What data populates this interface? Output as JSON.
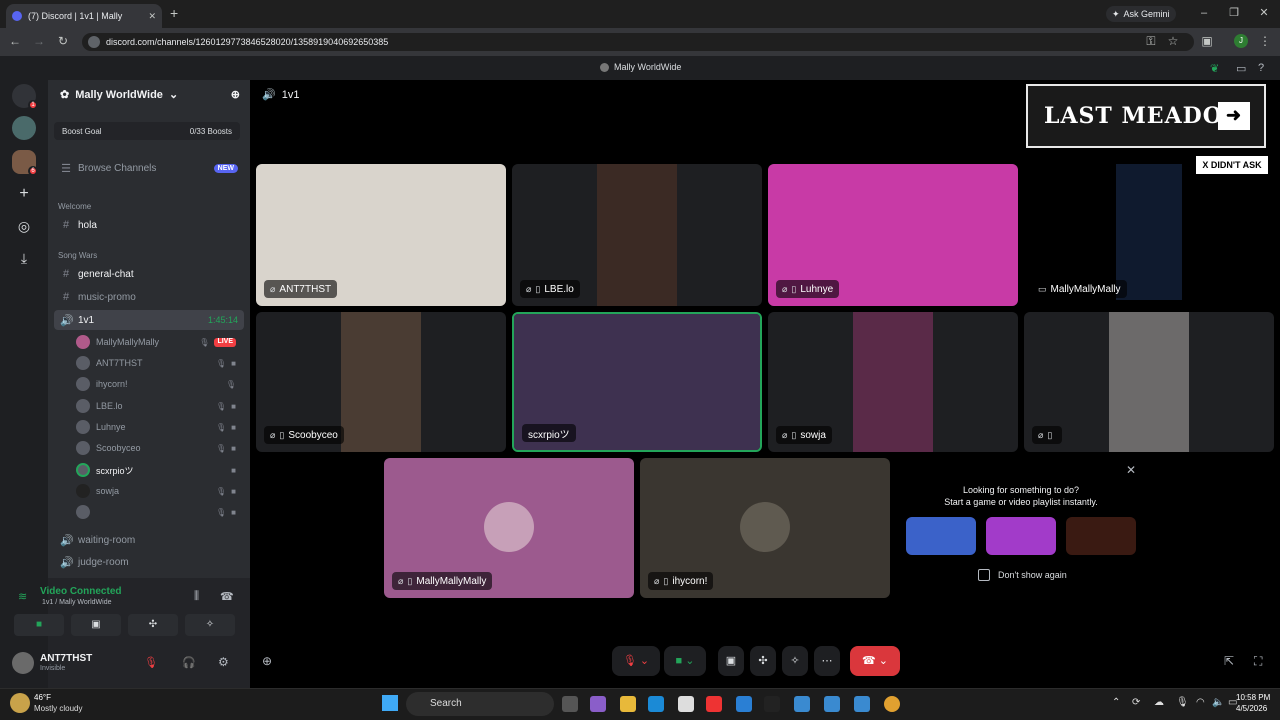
{
  "browser": {
    "tab_title": "(7) Discord | 1v1 | Mally",
    "url": "discord.com/channels/1260129773846528020/1358919040692650385",
    "ask_gemini": "Ask Gemini"
  },
  "header": {
    "title": "Mally WorldWide"
  },
  "rail": {
    "home_badge": "1",
    "server_badge": "6"
  },
  "sidebar": {
    "guild_name": "Mally WorldWide",
    "boost_goal": "Boost Goal",
    "boost_count": "0/33 Boosts",
    "browse": "Browse Channels",
    "browse_badge": "NEW",
    "cat_welcome": "Welcome",
    "ch_hola": "hola",
    "cat_songwars": "Song Wars",
    "ch_general": "general-chat",
    "ch_promo": "music-promo",
    "ch_1v1": "1v1",
    "ch_1v1_time": "1:45:14",
    "users": [
      "MallyMallyMally",
      "ANT7THST",
      "ihycorn!",
      "LBE.lo",
      "Luhnye",
      "Scoobyceo",
      "scxrpioツ",
      "sowja",
      ""
    ],
    "live_badge": "LIVE",
    "ch_waiting": "waiting-room",
    "ch_judge": "judge-room"
  },
  "voice": {
    "status": "Video Connected",
    "sub": "1v1 / Mally WorldWide"
  },
  "account": {
    "name": "ANT7THST",
    "status": "Invisible"
  },
  "channel_header": "1v1",
  "tiles": [
    {
      "name": "ANT7THST",
      "color": "#d9d4cc"
    },
    {
      "name": "LBE.lo",
      "color": "#3b2a24"
    },
    {
      "name": "Luhnye",
      "color": "#c83aa6"
    },
    {
      "name": "MallyMallyMally",
      "color": "#000000"
    },
    {
      "name": "Scoobyceo",
      "color": "#4a3c33"
    },
    {
      "name": "scxrpioツ",
      "color": "#3e3150"
    },
    {
      "name": "sowja",
      "color": "#5a2a48"
    },
    {
      "name": "",
      "color": "#6c6a6a"
    },
    {
      "name": "MallyMallyMally",
      "color": "#9c5a8e"
    },
    {
      "name": "ihycorn!",
      "color": "#3a3630"
    }
  ],
  "ad": {
    "title": "LAST MEADOW",
    "arrow": "➜",
    "tag": "X DIDN'T ASK"
  },
  "suggest": {
    "line1": "Looking for something to do?",
    "line2": "Start a game or video playlist instantly.",
    "checkbox": "Don't show again",
    "close": "✕"
  },
  "taskbar": {
    "temp": "46°F",
    "weather": "Mostly cloudy",
    "search": "Search",
    "time": "10:58 PM",
    "date": "4/5/2026"
  }
}
